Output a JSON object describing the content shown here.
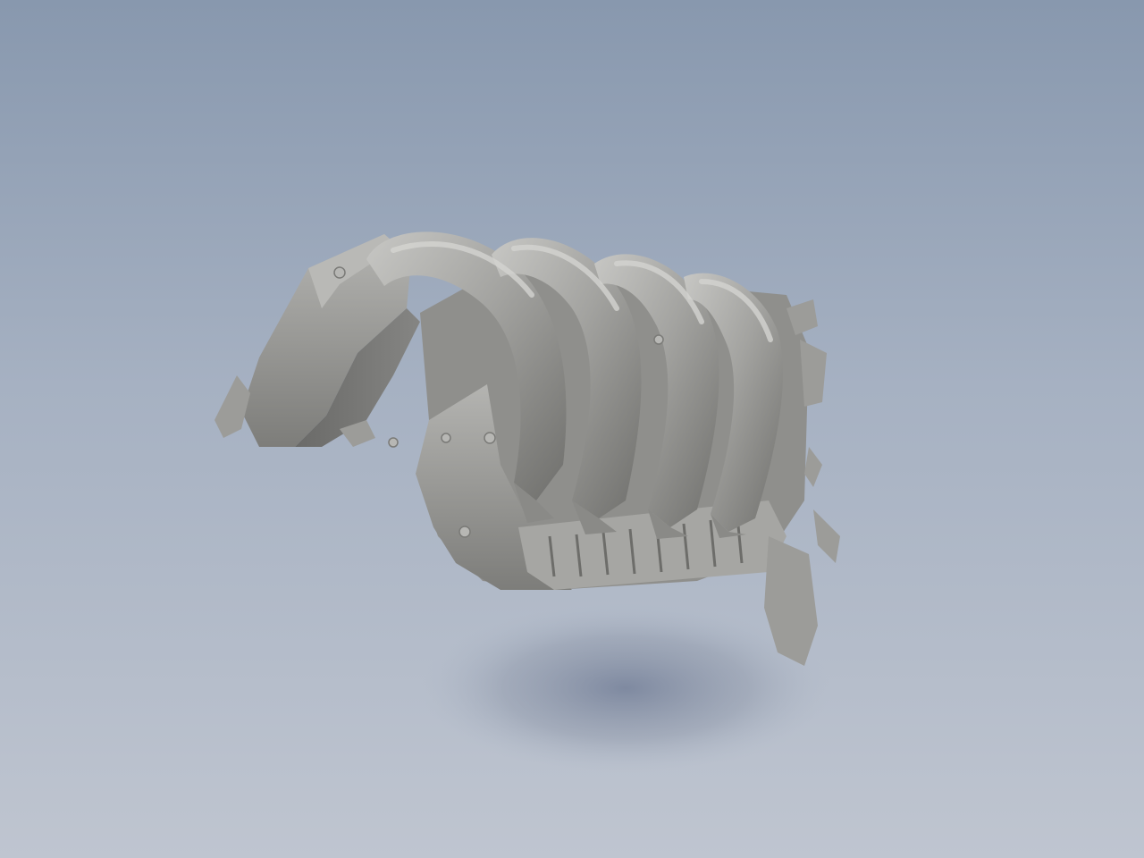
{
  "viewport": {
    "background_top": "#8898ae",
    "background_bottom": "#bfc5d0"
  },
  "model": {
    "icon": "3d-scanned-part-icon",
    "surface_color": "#9a9a97",
    "shadow_color": "#7e889c"
  }
}
